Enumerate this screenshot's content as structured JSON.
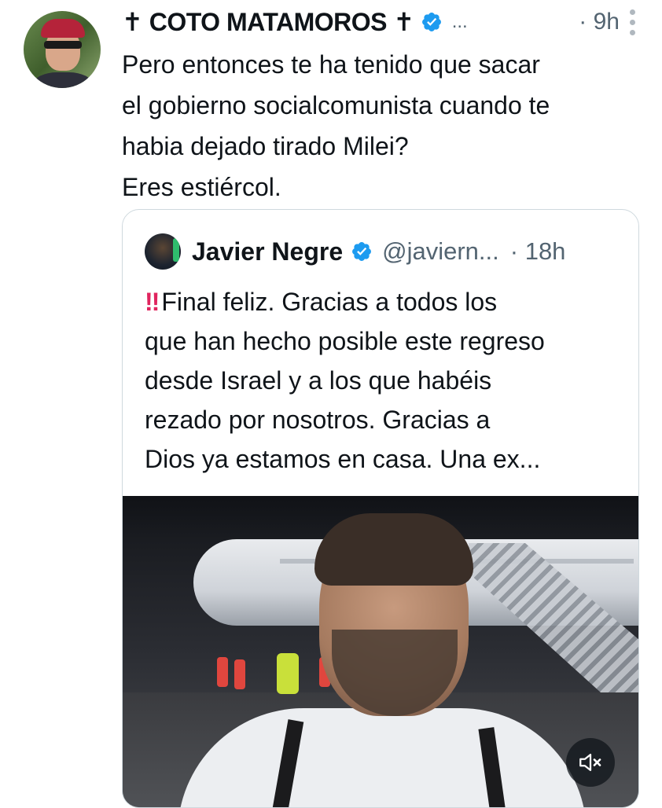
{
  "tweet": {
    "author_name": "✝ COTO MATAMOROS ✝",
    "more_indicator": "...",
    "time": "· 9h",
    "text": "Pero entonces te ha tenido que sacar\nel gobierno socialcomunista cuando te\nhabia dejado tirado Milei?\nEres estiércol."
  },
  "quoted": {
    "author_name": "Javier Negre",
    "handle": "@javiern...",
    "time": "· 18h",
    "emoji": "‼",
    "text": "Final feliz. Gracias a todos los\nque han hecho posible este regreso\ndesde Israel y a los que habéis\nrezado por nosotros. Gracias a\nDios ya estamos en casa. Una ex..."
  },
  "icons": {
    "verified": "verified-badge-icon",
    "more": "more-options-icon",
    "mute": "speaker-muted-icon"
  },
  "colors": {
    "verified": "#1d9bf0",
    "text": "#0f1419",
    "secondary": "#536471",
    "border": "#cfd9de",
    "emoji": "#e0245e"
  }
}
